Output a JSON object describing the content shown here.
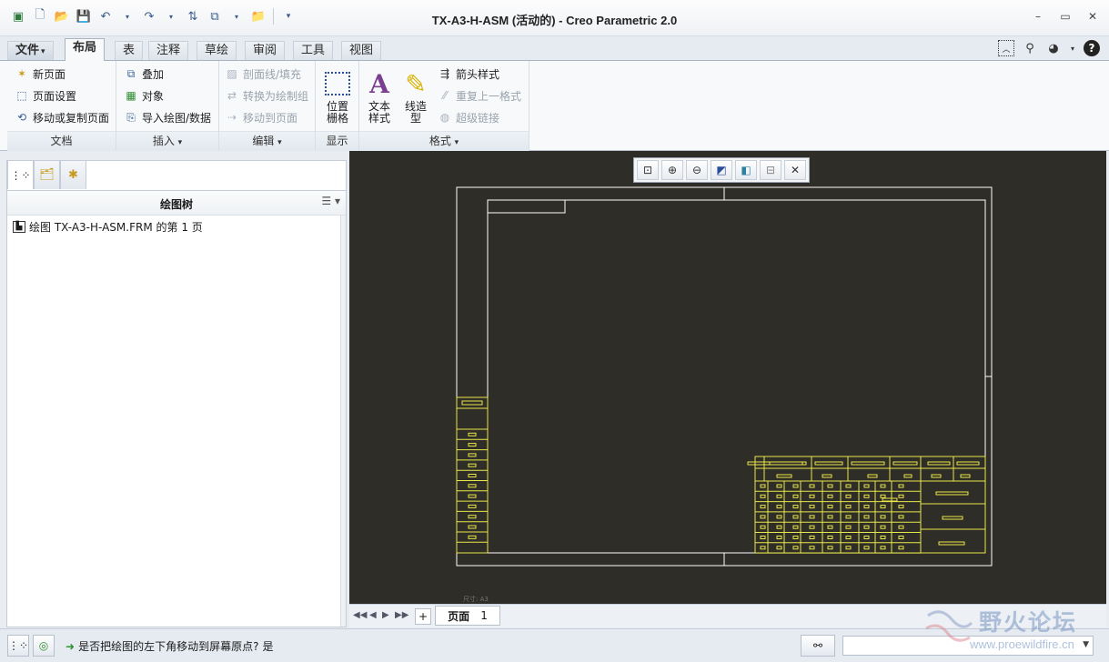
{
  "window": {
    "title": "TX-A3-H-ASM (活动的) - Creo Parametric 2.0"
  },
  "tabs": [
    {
      "label": "文件",
      "suffix": "▾"
    },
    {
      "label": "布局"
    },
    {
      "label": "表"
    },
    {
      "label": "注释"
    },
    {
      "label": "草绘"
    },
    {
      "label": "审阅"
    },
    {
      "label": "工具"
    },
    {
      "label": "视图"
    }
  ],
  "ribbon": {
    "document": {
      "label": "文档",
      "new_page": "新页面",
      "page_setup": "页面设置",
      "move_copy_page": "移动或复制页面"
    },
    "insert": {
      "label": "插入",
      "overlay": "叠加",
      "object": "对象",
      "import_drawing": "导入绘图/数据"
    },
    "edit": {
      "label": "编辑",
      "hatch_fill": "剖面线/填充",
      "convert_group": "转换为绘制组",
      "move_to_page": "移动到页面"
    },
    "display": {
      "label": "显示",
      "position_grid": "位置栅格"
    },
    "format": {
      "label": "格式",
      "text_style": "文本样式",
      "line_style": "线造型",
      "arrow_style": "箭头样式",
      "repeat_format": "重复上一格式",
      "hyperlink": "超级链接"
    },
    "dropdown_mark": "▾"
  },
  "tree": {
    "title": "绘图树",
    "item": "绘图 TX-A3-H-ASM.FRM 的第 1 页"
  },
  "page_tabs": {
    "add": "+",
    "label": "页面",
    "number": "1"
  },
  "status": {
    "message": "是否把绘图的左下角移动到屏幕原点?",
    "answer": "是"
  },
  "drawing": {
    "sheet_label": "尺寸: A3"
  },
  "watermark": {
    "text": "野火论坛",
    "url": "www.proewildfire.cn"
  },
  "colors": {
    "canvas": "#2f2d27",
    "border": "#ffffff",
    "title_block": "#e8e84a"
  }
}
